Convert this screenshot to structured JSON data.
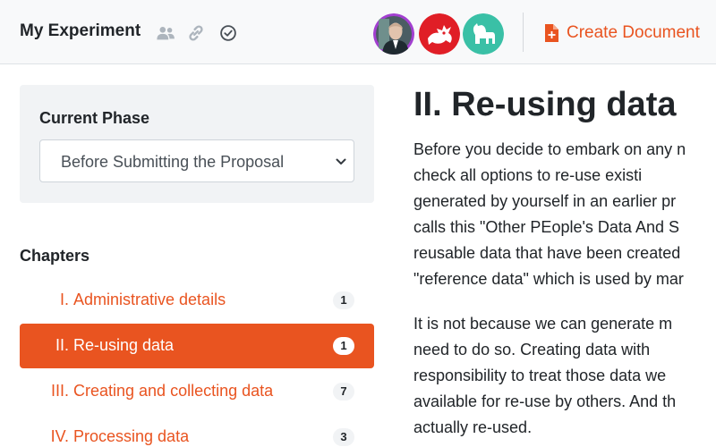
{
  "header": {
    "title": "My Experiment",
    "create_document_label": "Create Document"
  },
  "phase": {
    "label": "Current Phase",
    "selected": "Before Submitting the Proposal"
  },
  "chapters": {
    "heading": "Chapters",
    "items": [
      {
        "num": "I.",
        "name": "Administrative details",
        "count": "1"
      },
      {
        "num": "II.",
        "name": "Re-using data",
        "count": "1"
      },
      {
        "num": "III.",
        "name": "Creating and collecting data",
        "count": "7"
      },
      {
        "num": "IV.",
        "name": "Processing data",
        "count": "3"
      }
    ]
  },
  "content": {
    "title": "II. Re-using data",
    "paragraph1": [
      "Before you decide to embark on any n",
      "check  all  options  to  re-use  existi",
      "generated by yourself in an earlier pr",
      "calls this \"Other PEople's Data And S",
      "reusable data that have been created",
      "\"reference data\" which is used by mar"
    ],
    "paragraph2": [
      "It is not because we can generate m",
      "need  to  do  so.  Creating  data  with",
      "responsibility to treat those data we",
      "available for re-use by others. And th",
      "actually re-used."
    ]
  },
  "colors": {
    "accent": "#e95420",
    "header_bg": "#f8f9fa",
    "panel_bg": "#f1f3f5"
  }
}
